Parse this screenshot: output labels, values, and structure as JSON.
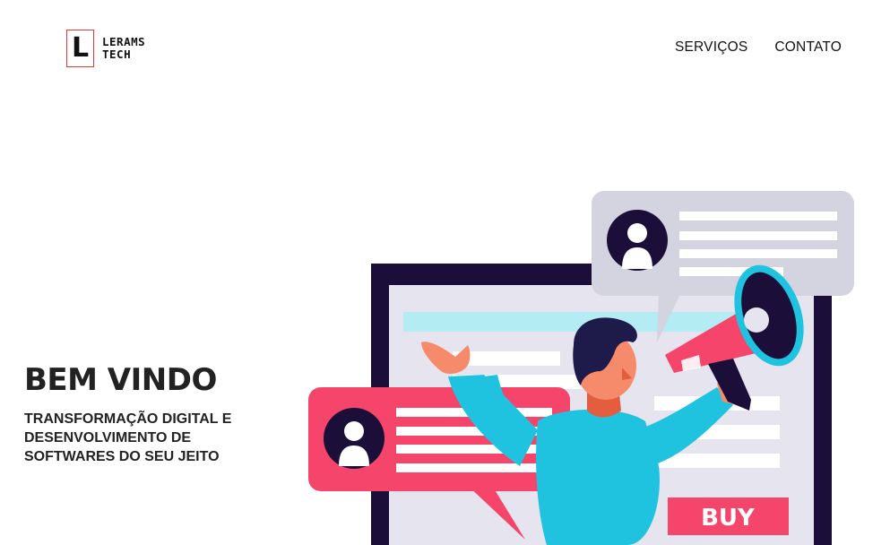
{
  "header": {
    "logo": {
      "letter": "L",
      "line1": "LERAMS",
      "line2": "TECH"
    },
    "nav": [
      {
        "label": "SERVIÇOS"
      },
      {
        "label": "CONTATO"
      }
    ]
  },
  "hero": {
    "title": "BEM VINDO",
    "subtitle": "TRANSFORMAÇÃO DIGITAL E DESENVOLVIMENTO DE SOFTWARES DO SEU JEITO"
  },
  "illustration": {
    "buy_label": "BUY",
    "colors": {
      "frame": "#1b0f3a",
      "panel": "#e6e4ef",
      "bubble_gray": "#d4d3e0",
      "bubble_pink": "#f5456a",
      "teal": "#b3ecf2",
      "shirt": "#1fc3e0",
      "skin": "#f58b6b",
      "hair": "#1e1a4a",
      "megaphone_red": "#f5456a",
      "megaphone_rim": "#1fc3e0"
    }
  }
}
